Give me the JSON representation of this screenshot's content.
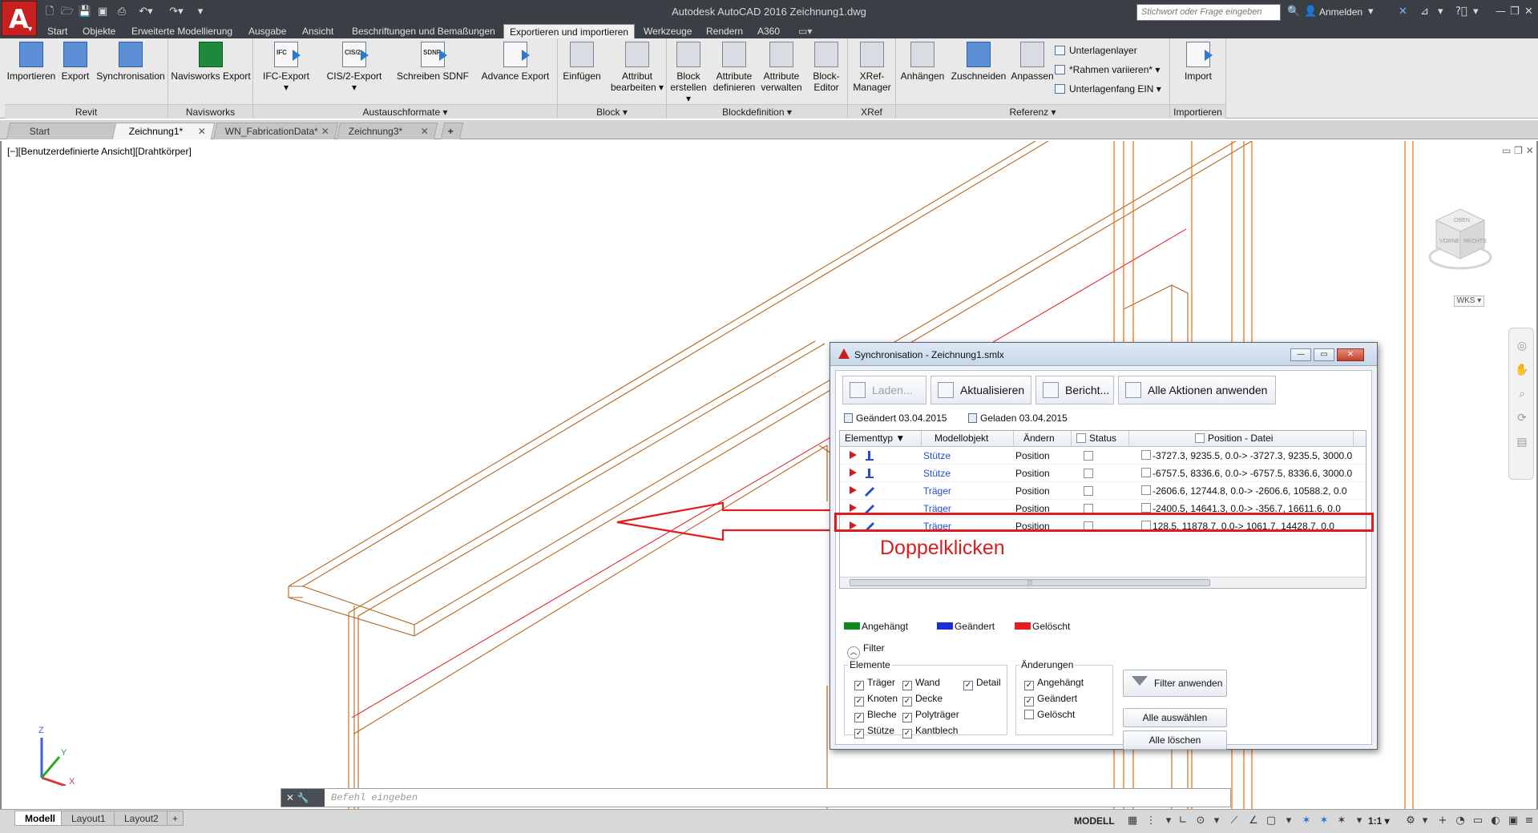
{
  "titlebar": {
    "app_letter": "A",
    "window_title": "Autodesk AutoCAD 2016     Zeichnung1.dwg",
    "search_placeholder": "Stichwort oder Frage eingeben",
    "signin": "Anmelden"
  },
  "ribbon_tabs": [
    "Start",
    "Objekte",
    "Erweiterte Modellierung",
    "Ausgabe",
    "Ansicht",
    "Beschriftungen und Bemaßungen",
    "Exportieren und importieren",
    "Werkzeuge",
    "Rendern",
    "A360"
  ],
  "ribbon_active_tab": "Exportieren und importieren",
  "ribbon": {
    "groups": {
      "revit": "Revit",
      "navisworks": "Navisworks",
      "austausch": "Austauschformate ▾",
      "block": "Block ▾",
      "blockdef": "Blockdefinition ▾",
      "xref": "XRef",
      "referenz": "Referenz ▾",
      "importieren": "Importieren"
    },
    "buttons": {
      "importieren": "Importieren",
      "export": "Export",
      "synchronisation": "Synchronisation",
      "navisworks_export": "Navisworks Export",
      "ifc_export": "IFC-Export ▾",
      "cis2_export": "CIS/2-Export ▾",
      "schreiben_sdnf": "Schreiben SDNF",
      "advance_export": "Advance Export",
      "einfuegen": "Einfügen",
      "attribut_bearbeiten_1": "Attribut",
      "attribut_bearbeiten_2": "bearbeiten ▾",
      "block_erstellen_1": "Block",
      "block_erstellen_2": "erstellen ▾",
      "attribute_definieren_1": "Attribute",
      "attribute_definieren_2": "definieren",
      "attribute_verwalten_1": "Attribute",
      "attribute_verwalten_2": "verwalten",
      "block_editor_1": "Block-",
      "block_editor_2": "Editor",
      "xref_manager_1": "XRef-",
      "xref_manager_2": "Manager",
      "anhaengen": "Anhängen",
      "zuschneiden": "Zuschneiden",
      "anpassen": "Anpassen",
      "import": "Import"
    },
    "icon_tags": {
      "ifc": "IFC",
      "cis2": "CIS/2",
      "sdnf": "SDNF"
    },
    "small": {
      "unterlagenlayer": "Unterlagenlayer",
      "rahmen": "*Rahmen variieren* ▾",
      "unterlagenfang": "Unterlagenfang EIN ▾"
    }
  },
  "doc_tabs": [
    "Start",
    "Zeichnung1*",
    "WN_FabricationData*",
    "Zeichnung3*"
  ],
  "doc_tab_close": "✕",
  "doc_tab_add": "+",
  "viewport_label": "[−][Benutzerdefinierte Ansicht][Drahtkörper]",
  "viewcube": {
    "top": "OBEN",
    "front": "VORNE",
    "right": "RECHTS",
    "wcs": "WKS ▾"
  },
  "ucs": {
    "x": "X",
    "y": "Y",
    "z": "Z"
  },
  "command": {
    "placeholder": "Befehl eingeben",
    "close": "✕",
    "settings": "🔧"
  },
  "layout_tabs": [
    "Modell",
    "Layout1",
    "Layout2"
  ],
  "layout_add": "+",
  "status": {
    "model": "MODELL",
    "scale": "1:1 ▾"
  },
  "dialog": {
    "title": "Synchronisation - Zeichnung1.smlx",
    "buttons": {
      "laden": "Laden...",
      "aktualisieren": "Aktualisieren",
      "bericht": "Bericht...",
      "alle_aktionen": "Alle Aktionen anwenden"
    },
    "changed": "Geändert 03.04.2015",
    "loaded": "Geladen 03.04.2015",
    "columns": {
      "elementtyp": "Elementtyp",
      "modellobjekt": "Modellobjekt",
      "aendern": "Ändern",
      "status": "Status",
      "position": "Position - Datei"
    },
    "rows": [
      {
        "model": "Stütze",
        "change": "Position",
        "pos": "-3727.3, 9235.5, 0.0-> -3727.3, 9235.5, 3000.0"
      },
      {
        "model": "Stütze",
        "change": "Position",
        "pos": "-6757.5, 8336.6, 0.0-> -6757.5, 8336.6, 3000.0"
      },
      {
        "model": "Träger",
        "change": "Position",
        "pos": "-2606.6, 12744.8, 0.0-> -2606.6, 10588.2, 0.0"
      },
      {
        "model": "Träger",
        "change": "Position",
        "pos": "-2400.5, 14641.3, 0.0-> -356.7, 16611.6, 0.0"
      },
      {
        "model": "Träger",
        "change": "Position",
        "pos": "128.5, 11878.7, 0.0-> 1061.7, 14428.7, 0.0"
      }
    ],
    "legend": {
      "attached": "Angehängt",
      "changed": "Geändert",
      "deleted": "Gelöscht"
    },
    "legend_colors": {
      "attached": "#0e8a1c",
      "changed": "#1b2fd6",
      "deleted": "#e51d1d"
    },
    "filter_label": "Filter",
    "elements_label": "Elemente",
    "elements": [
      "Träger",
      "Wand",
      "Detail",
      "Knoten",
      "Decke",
      "Bleche",
      "Polyträger",
      "Stütze",
      "Kantblech"
    ],
    "changes_label": "Änderungen",
    "changes": [
      "Angehängt",
      "Geändert",
      "Gelöscht"
    ],
    "apply_filter": "Filter anwenden",
    "select_all": "Alle auswählen",
    "clear_all": "Alle löschen"
  },
  "annotation": {
    "text": "Doppelklicken",
    "color": "#d41f1f"
  },
  "colors": {
    "accent": "#c8201f",
    "drawing_lines": "#b5651d",
    "orange_columns": "#f07a1a"
  }
}
